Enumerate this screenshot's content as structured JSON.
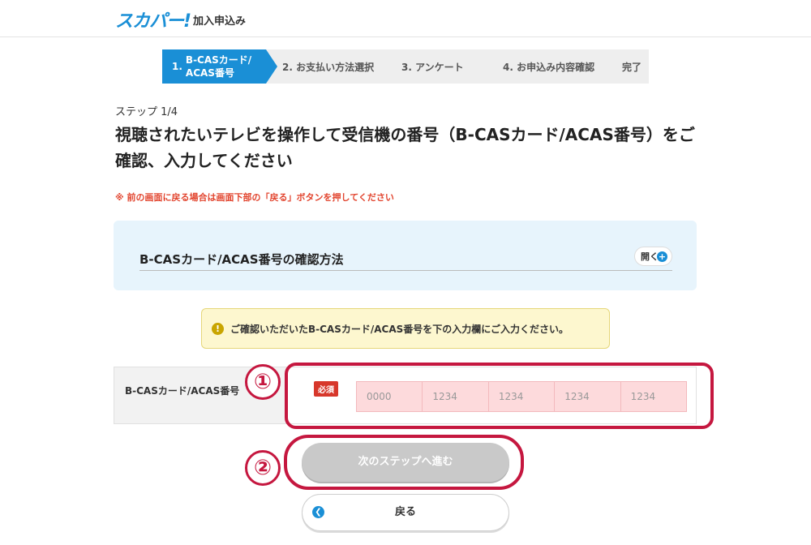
{
  "header": {
    "logo_text": "スカパー!",
    "subtitle": "加入申込み"
  },
  "steps": [
    {
      "num": "1.",
      "label_line1": "B-CASカード/",
      "label_line2": "ACAS番号",
      "active": true
    },
    {
      "label": "2. お支払い方法選択"
    },
    {
      "label": "3. アンケート"
    },
    {
      "label": "4. お申込み内容確認"
    },
    {
      "label": "完了"
    }
  ],
  "page": {
    "step_count": "ステップ 1/4",
    "title": "視聴されたいテレビを操作して受信機の番号（B-CASカード/ACAS番号）をご確認、入力してください",
    "notice": "※ 前の画面に戻る場合は画面下部の「戻る」ボタンを押してください"
  },
  "howto": {
    "title": "B-CASカード/ACAS番号の確認方法",
    "open_label": "開く",
    "open_icon": "plus-circle-icon"
  },
  "info": {
    "icon": "exclamation-circle-icon",
    "text": "ご確認いただいたB-CASカード/ACAS番号を下の入力欄にご入力ください。"
  },
  "form": {
    "label": "B-CASカード/ACAS番号",
    "required_badge": "必須",
    "placeholders": [
      "0000",
      "1234",
      "1234",
      "1234",
      "1234"
    ]
  },
  "annotations": {
    "marker1": "①",
    "marker2": "②",
    "accent_color": "#c5173f"
  },
  "buttons": {
    "next_label": "次のステップへ進む",
    "back_label": "戻る",
    "back_icon": "chevron-left-icon"
  },
  "colors": {
    "brand": "#1a8fd6",
    "notice": "#e2452f",
    "required": "#d7372b"
  }
}
